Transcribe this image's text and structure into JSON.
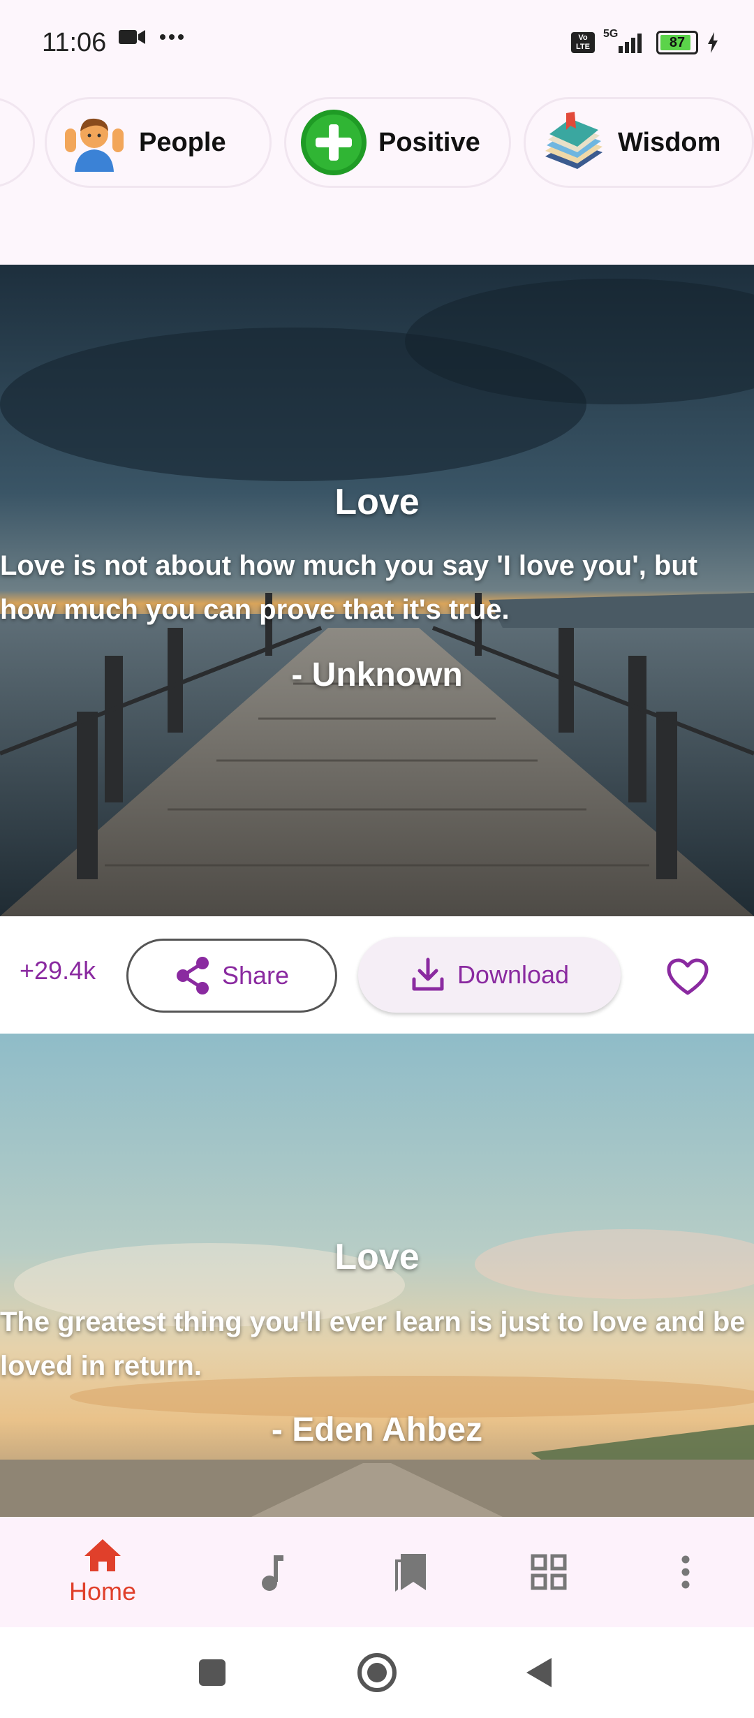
{
  "status_bar": {
    "time": "11:06",
    "network": "5G",
    "battery_level": "87",
    "volte_label": "Vo LTE"
  },
  "categories": [
    {
      "label": "People",
      "icon": "person-avatar-icon"
    },
    {
      "label": "Positive",
      "icon": "plus-circle-icon"
    },
    {
      "label": "Wisdom",
      "icon": "books-icon"
    }
  ],
  "cards": [
    {
      "title": "Love",
      "quote": "Love is not about how much you say 'I love you', but how much you can prove that it's true.",
      "author": "- Unknown"
    },
    {
      "title": "Love",
      "quote": "The greatest thing you'll ever learn is just to love and be loved in return.",
      "author": "- Eden Ahbez"
    }
  ],
  "actions": {
    "likes": "+29.4k",
    "share_label": "Share",
    "download_label": "Download"
  },
  "bottom_nav": {
    "home_label": "Home",
    "items": [
      "home-icon",
      "music-note-icon",
      "bookmarks-icon",
      "grid-icon",
      "more-vert-icon"
    ]
  },
  "colors": {
    "accent": "#8a2aa0",
    "home_active": "#e0402b",
    "background": "#fdf6fc"
  }
}
